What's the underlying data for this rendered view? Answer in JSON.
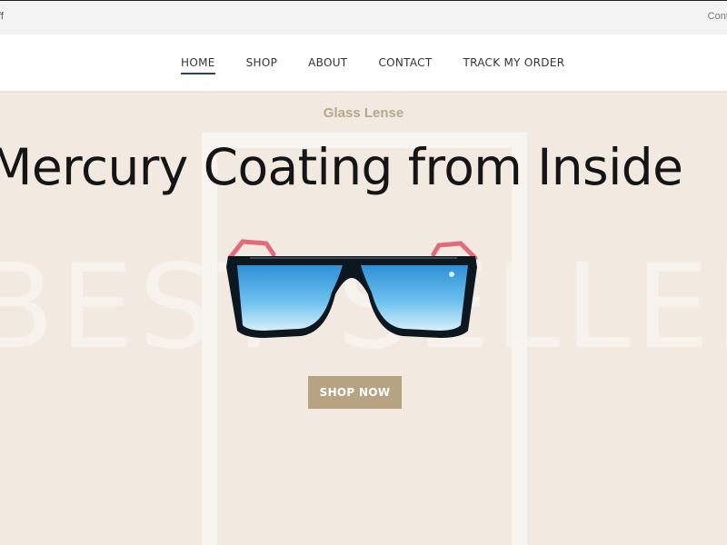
{
  "topbar": {
    "left_text": "ff",
    "right_text": "Conta"
  },
  "nav": {
    "items": [
      {
        "label": "HOME",
        "active": true
      },
      {
        "label": "SHOP",
        "active": false
      },
      {
        "label": "ABOUT",
        "active": false
      },
      {
        "label": "CONTACT",
        "active": false
      },
      {
        "label": "TRACK MY ORDER",
        "active": false
      }
    ]
  },
  "hero": {
    "subtitle": "Glass Lense",
    "headline": "Mercury Coating from Inside",
    "background_word": "BEST SELLER",
    "product_image": "sunglasses-image",
    "cta_label": "SHOP NOW"
  },
  "colors": {
    "hero_bg": "#f2eae1",
    "accent": "#b6a382",
    "nav_active_underline": "#2b4560",
    "lens": "#3aa3e0"
  }
}
